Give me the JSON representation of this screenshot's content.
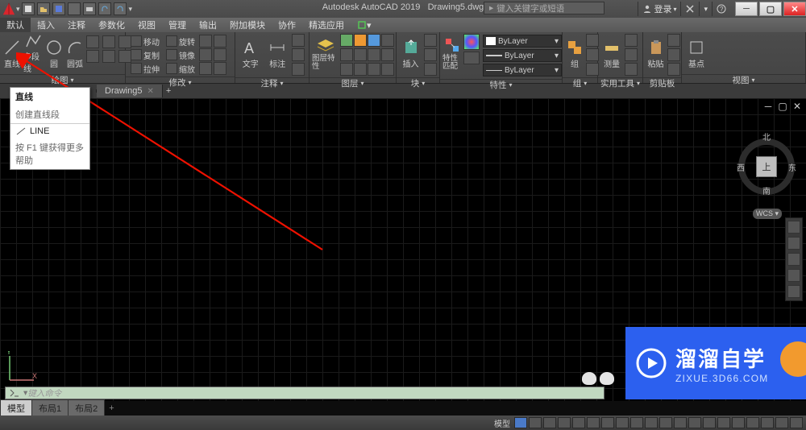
{
  "title": {
    "app": "Autodesk AutoCAD 2019",
    "file": "Drawing5.dwg"
  },
  "search": {
    "placeholder": "键入关键字或短语"
  },
  "login": {
    "label": "登录"
  },
  "menu": [
    "默认",
    "插入",
    "注释",
    "参数化",
    "视图",
    "管理",
    "输出",
    "附加模块",
    "协作",
    "精选应用"
  ],
  "draw": {
    "line": "直线",
    "pline": "多段线",
    "circle": "圆",
    "arc": "圆弧",
    "panel": "绘图"
  },
  "modify": {
    "move": "移动",
    "copy": "复制",
    "stretch": "拉伸",
    "rotate": "旋转",
    "mirror": "镜像",
    "scale": "缩放",
    "panel": "修改"
  },
  "annotate": {
    "text": "文字",
    "dim": "标注",
    "panel": "注释"
  },
  "layers": {
    "main": "图层特性",
    "panel": "图层"
  },
  "block": {
    "insert": "插入",
    "panel": "块"
  },
  "prop": {
    "match": "特性匹配",
    "sel": "ByLayer",
    "panel": "特性"
  },
  "group": {
    "main": "组",
    "panel": "组"
  },
  "util": {
    "measure": "测量",
    "panel": "实用工具"
  },
  "clip": {
    "paste": "粘贴",
    "panel": "剪贴板"
  },
  "view": {
    "base": "基点",
    "panel": "视图"
  },
  "filetab": {
    "name": "Drawing5"
  },
  "tooltip": {
    "title": "直线",
    "desc": "创建直线段",
    "cmd": "LINE",
    "help": "按 F1 键获得更多帮助"
  },
  "cube": {
    "top": "上",
    "n": "北",
    "s": "南",
    "e": "东",
    "w": "西",
    "wcs": "WCS"
  },
  "cmd": {
    "placeholder": "键入命令"
  },
  "layout": {
    "model": "模型",
    "l1": "布局1",
    "l2": "布局2"
  },
  "status": {
    "model": "模型"
  },
  "watermark": {
    "brand": "溜溜自学",
    "url": "ZIXUE.3D66.COM"
  }
}
